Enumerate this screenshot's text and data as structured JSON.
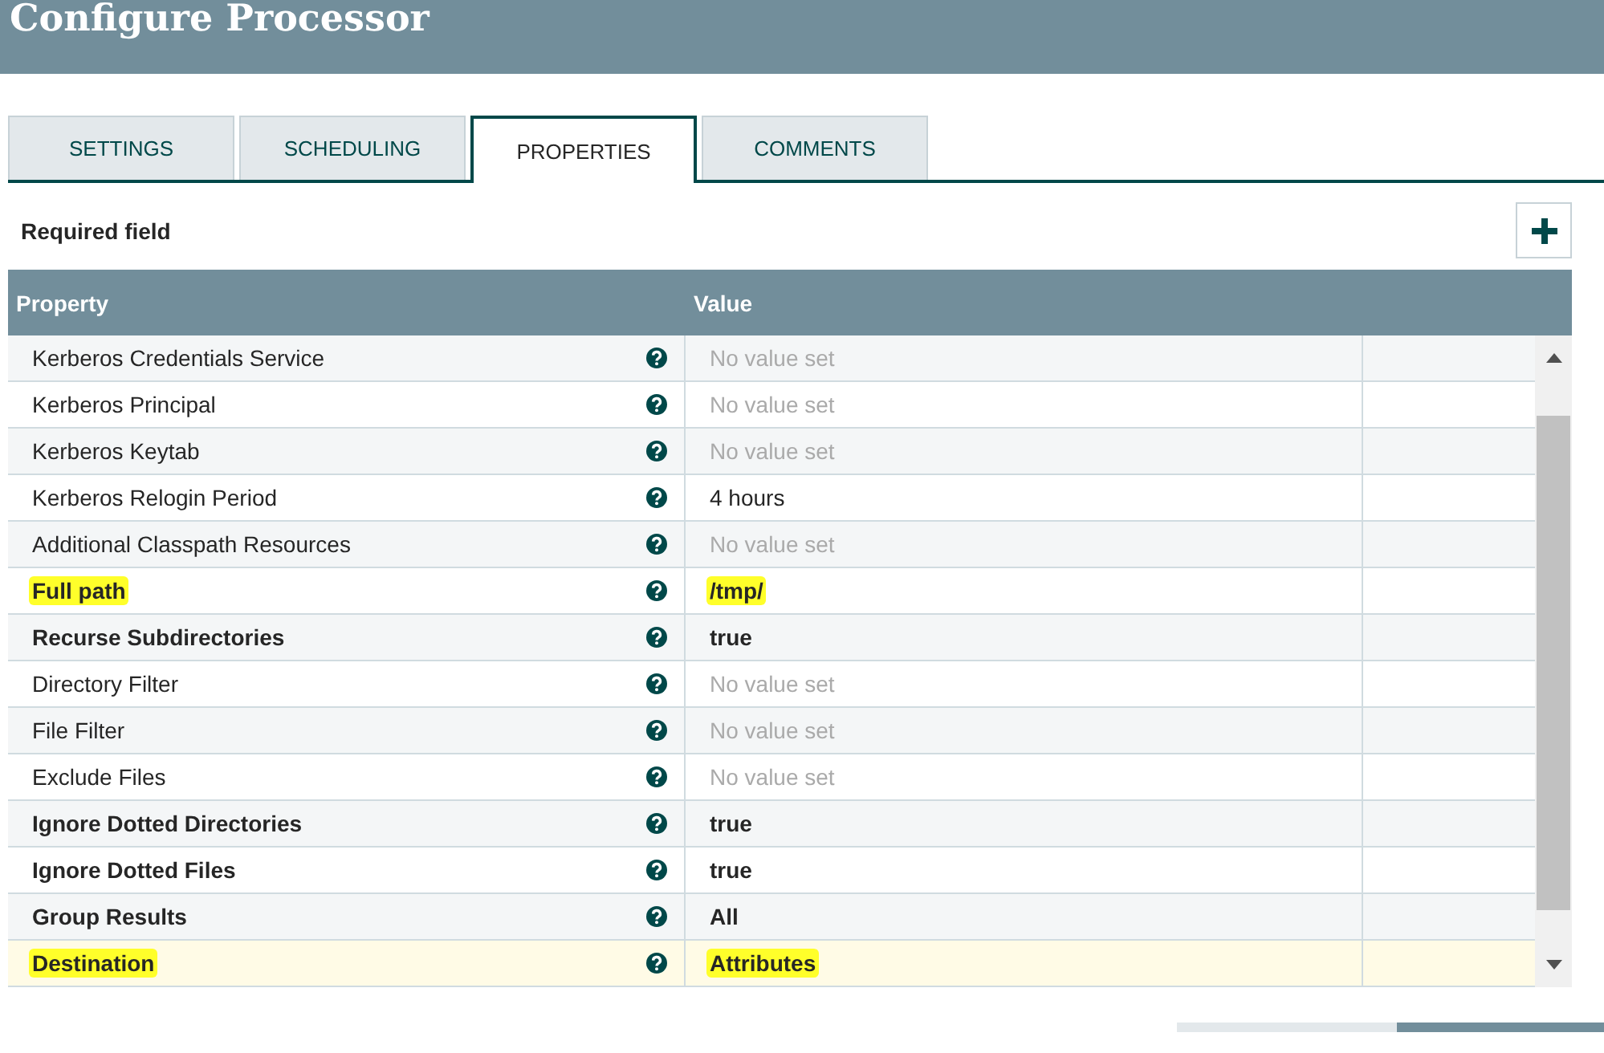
{
  "window": {
    "title": "Configure Processor"
  },
  "tabs": [
    {
      "label": "SETTINGS",
      "selected": false
    },
    {
      "label": "SCHEDULING",
      "selected": false
    },
    {
      "label": "PROPERTIES",
      "selected": true
    },
    {
      "label": "COMMENTS",
      "selected": false
    }
  ],
  "required_note": "Required field",
  "table": {
    "columns": [
      "Property",
      "Value"
    ],
    "rows": [
      {
        "property": "Kerberos Credentials Service",
        "value": "No value set",
        "required": false,
        "value_set": false,
        "highlighted": false,
        "selected": false
      },
      {
        "property": "Kerberos Principal",
        "value": "No value set",
        "required": false,
        "value_set": false,
        "highlighted": false,
        "selected": false
      },
      {
        "property": "Kerberos Keytab",
        "value": "No value set",
        "required": false,
        "value_set": false,
        "highlighted": false,
        "selected": false
      },
      {
        "property": "Kerberos Relogin Period",
        "value": "4 hours",
        "required": false,
        "value_set": true,
        "highlighted": false,
        "selected": false
      },
      {
        "property": "Additional Classpath Resources",
        "value": "No value set",
        "required": false,
        "value_set": false,
        "highlighted": false,
        "selected": false
      },
      {
        "property": "Full path",
        "value": "/tmp/",
        "required": true,
        "value_set": true,
        "highlighted": true,
        "selected": false
      },
      {
        "property": "Recurse Subdirectories",
        "value": "true",
        "required": true,
        "value_set": true,
        "highlighted": false,
        "selected": false
      },
      {
        "property": "Directory Filter",
        "value": "No value set",
        "required": false,
        "value_set": false,
        "highlighted": false,
        "selected": false
      },
      {
        "property": "File Filter",
        "value": "No value set",
        "required": false,
        "value_set": false,
        "highlighted": false,
        "selected": false
      },
      {
        "property": "Exclude Files",
        "value": "No value set",
        "required": false,
        "value_set": false,
        "highlighted": false,
        "selected": false
      },
      {
        "property": "Ignore Dotted Directories",
        "value": "true",
        "required": true,
        "value_set": true,
        "highlighted": false,
        "selected": false
      },
      {
        "property": "Ignore Dotted Files",
        "value": "true",
        "required": true,
        "value_set": true,
        "highlighted": false,
        "selected": false
      },
      {
        "property": "Group Results",
        "value": "All",
        "required": true,
        "value_set": true,
        "highlighted": false,
        "selected": false
      },
      {
        "property": "Destination",
        "value": "Attributes",
        "required": true,
        "value_set": true,
        "highlighted": true,
        "selected": true
      }
    ]
  }
}
